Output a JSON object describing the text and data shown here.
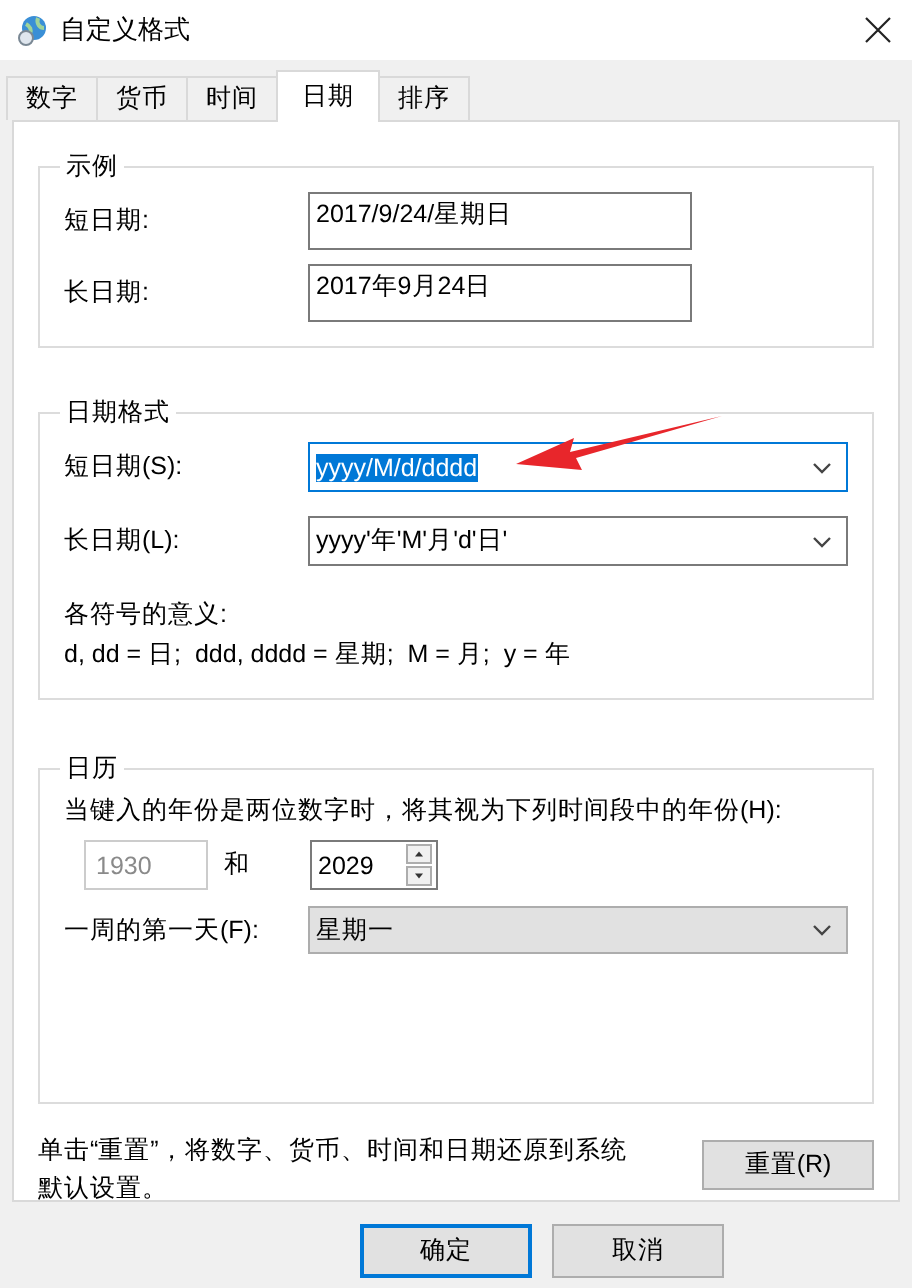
{
  "window": {
    "title": "自定义格式"
  },
  "tabs": [
    {
      "label": "数字",
      "selected": false
    },
    {
      "label": "货币",
      "selected": false
    },
    {
      "label": "时间",
      "selected": false
    },
    {
      "label": "日期",
      "selected": true
    },
    {
      "label": "排序",
      "selected": false
    }
  ],
  "example": {
    "title": "示例",
    "rows": [
      {
        "label": "短日期:",
        "value": "2017/9/24/星期日"
      },
      {
        "label": "长日期:",
        "value": "2017年9月24日"
      }
    ]
  },
  "date_formats": {
    "title": "日期格式",
    "rows": [
      {
        "label": "短日期(S):",
        "value": "yyyy/M/d/dddd",
        "focused": true
      },
      {
        "label": "长日期(L):",
        "value": "yyyy'年'M'月'd'日'",
        "focused": false
      }
    ],
    "symbols_title": "各符号的意义:",
    "symbols_text": "d, dd = 日;  ddd, dddd = 星期;  M = 月;  y = 年"
  },
  "calendar": {
    "title": "日历",
    "two_digit_label": "当键入的年份是两位数字时，将其视为下列时间段中的年份(H):",
    "from_year": {
      "value": "1930",
      "disabled": true
    },
    "and": "和",
    "to_year": {
      "value": "2029"
    },
    "first_day_label": "一周的第一天(F):",
    "first_day": "星期一"
  },
  "reset_note": "单击“重置”，将数字、货币、时间和日期还原到系统默认设置。",
  "reset_button": "重置(R)",
  "buttons": [
    {
      "label": "确定",
      "default": true
    },
    {
      "label": "取消",
      "default": false
    }
  ]
}
